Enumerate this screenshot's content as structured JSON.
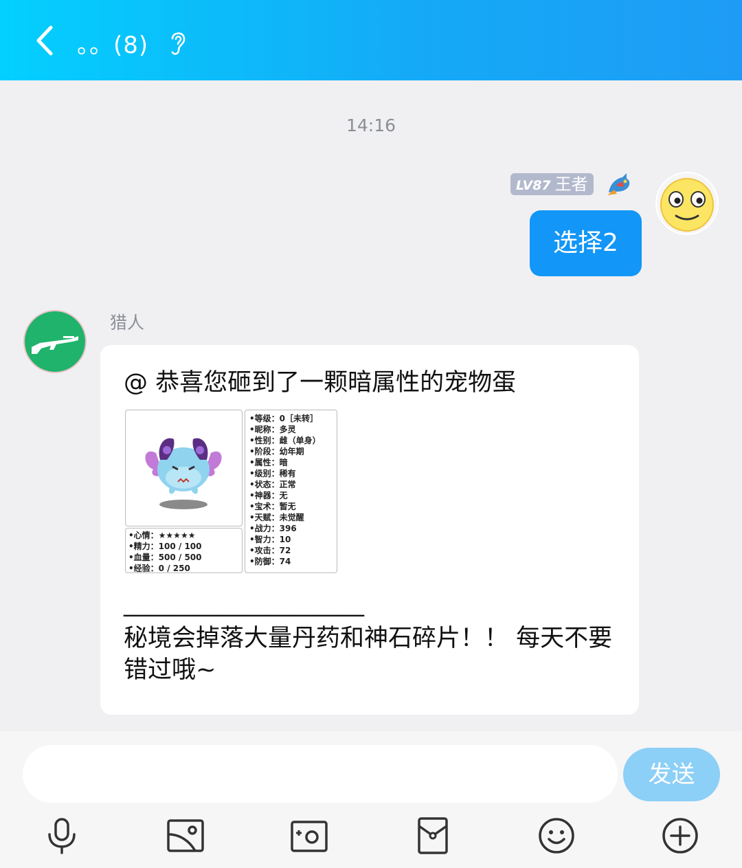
{
  "header": {
    "title": "。。(8)"
  },
  "chat": {
    "timestamp": "14:16",
    "me": {
      "level": "LV87",
      "rank": "王者",
      "message": "选择2"
    },
    "bot": {
      "name": "猎人",
      "head": "@ 恭喜您砸到了一颗暗属性的宠物蛋",
      "divider": "____________________",
      "body": "秘境会掉落大量丹药和神石碎片！！ 每天不要错过哦~",
      "pet_card": {
        "left_stats": [
          "•心情：★★★★★",
          "•精力：100 / 100",
          "•血量：500 / 500",
          "•经验：0 / 250"
        ],
        "right_stats": [
          "•等级：0［未转］",
          "•昵称：多灵",
          "•性别：雌（单身）",
          "•阶段：幼年期",
          "•属性：暗",
          "•级别：稀有",
          "•状态：正常",
          "•神器：无",
          "•宝术：暂无",
          "•天赋：未觉醒",
          "•战力：396",
          "•智力：10",
          "•攻击：72",
          "•防御：74"
        ]
      }
    }
  },
  "input": {
    "value": "",
    "send_label": "发送"
  },
  "toolbar": [
    "microphone-icon",
    "photo-icon",
    "camera-icon",
    "red-packet-icon",
    "emoji-icon",
    "plus-icon"
  ],
  "colors": {
    "header_start": "#03d0fe",
    "header_end": "#1e9cf5",
    "my_bubble": "#1296f7",
    "send_button": "#8ccff7",
    "bot_avatar": "#1fb36b"
  }
}
